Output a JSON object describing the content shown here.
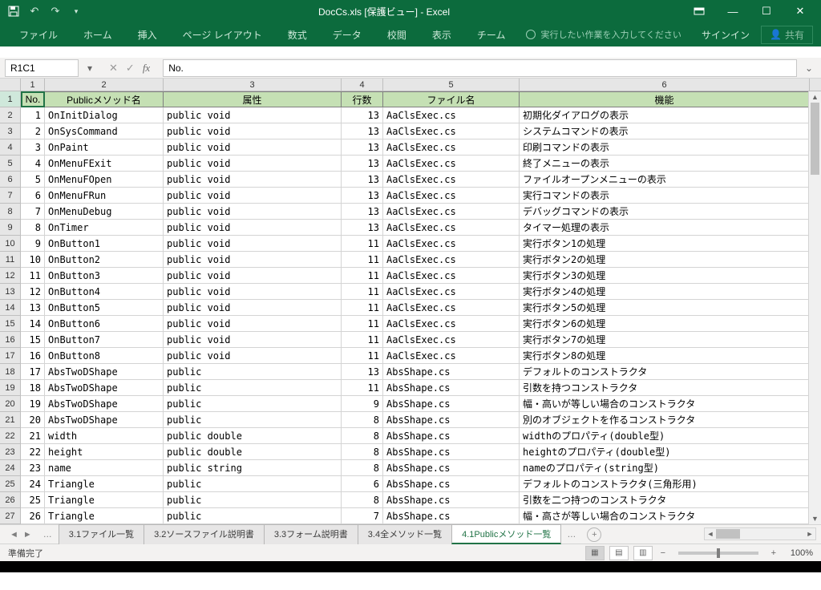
{
  "title": "DocCs.xls  [保護ビュー] - Excel",
  "qat": {
    "save": "💾"
  },
  "ribbon": {
    "tabs": [
      "ファイル",
      "ホーム",
      "挿入",
      "ページ レイアウト",
      "数式",
      "データ",
      "校閲",
      "表示",
      "チーム"
    ],
    "tellme": "実行したい作業を入力してください",
    "signin": "サインイン",
    "share": "共有"
  },
  "namebox": "R1C1",
  "formula": "No.",
  "colnums": [
    "1",
    "2",
    "3",
    "4",
    "5",
    "6"
  ],
  "headers": [
    "No.",
    "Publicメソッド名",
    "属性",
    "行数",
    "ファイル名",
    "機能"
  ],
  "rows": [
    {
      "n": "1",
      "no": "1",
      "m": "OnInitDialog",
      "a": "public void",
      "l": "13",
      "f": "AaClsExec.cs",
      "d": "初期化ダイアログの表示"
    },
    {
      "n": "2",
      "no": "2",
      "m": "OnSysCommand",
      "a": "public void",
      "l": "13",
      "f": "AaClsExec.cs",
      "d": "システムコマンドの表示"
    },
    {
      "n": "3",
      "no": "3",
      "m": "OnPaint",
      "a": "public void",
      "l": "13",
      "f": "AaClsExec.cs",
      "d": "印刷コマンドの表示"
    },
    {
      "n": "4",
      "no": "4",
      "m": "OnMenuFExit",
      "a": "public void",
      "l": "13",
      "f": "AaClsExec.cs",
      "d": "終了メニューの表示"
    },
    {
      "n": "5",
      "no": "5",
      "m": "OnMenuFOpen",
      "a": "public void",
      "l": "13",
      "f": "AaClsExec.cs",
      "d": "ファイルオープンメニューの表示"
    },
    {
      "n": "6",
      "no": "6",
      "m": "OnMenuFRun",
      "a": "public void",
      "l": "13",
      "f": "AaClsExec.cs",
      "d": "実行コマンドの表示"
    },
    {
      "n": "7",
      "no": "7",
      "m": "OnMenuDebug",
      "a": "public void",
      "l": "13",
      "f": "AaClsExec.cs",
      "d": "デバッグコマンドの表示"
    },
    {
      "n": "8",
      "no": "8",
      "m": "OnTimer",
      "a": "public void",
      "l": "13",
      "f": "AaClsExec.cs",
      "d": "タイマー処理の表示"
    },
    {
      "n": "9",
      "no": "9",
      "m": "OnButton1",
      "a": "public void",
      "l": "11",
      "f": "AaClsExec.cs",
      "d": "実行ボタン1の処理"
    },
    {
      "n": "10",
      "no": "10",
      "m": "OnButton2",
      "a": "public void",
      "l": "11",
      "f": "AaClsExec.cs",
      "d": "実行ボタン2の処理"
    },
    {
      "n": "11",
      "no": "11",
      "m": "OnButton3",
      "a": "public void",
      "l": "11",
      "f": "AaClsExec.cs",
      "d": "実行ボタン3の処理"
    },
    {
      "n": "12",
      "no": "12",
      "m": "OnButton4",
      "a": "public void",
      "l": "11",
      "f": "AaClsExec.cs",
      "d": "実行ボタン4の処理"
    },
    {
      "n": "13",
      "no": "13",
      "m": "OnButton5",
      "a": "public void",
      "l": "11",
      "f": "AaClsExec.cs",
      "d": "実行ボタン5の処理"
    },
    {
      "n": "14",
      "no": "14",
      "m": "OnButton6",
      "a": "public void",
      "l": "11",
      "f": "AaClsExec.cs",
      "d": "実行ボタン6の処理"
    },
    {
      "n": "15",
      "no": "15",
      "m": "OnButton7",
      "a": "public void",
      "l": "11",
      "f": "AaClsExec.cs",
      "d": "実行ボタン7の処理"
    },
    {
      "n": "16",
      "no": "16",
      "m": "OnButton8",
      "a": "public void",
      "l": "11",
      "f": "AaClsExec.cs",
      "d": "実行ボタン8の処理"
    },
    {
      "n": "17",
      "no": "17",
      "m": "AbsTwoDShape",
      "a": "public",
      "l": "13",
      "f": "AbsShape.cs",
      "d": "デフォルトのコンストラクタ"
    },
    {
      "n": "18",
      "no": "18",
      "m": "AbsTwoDShape",
      "a": "public",
      "l": "11",
      "f": "AbsShape.cs",
      "d": "引数を持つコンストラクタ"
    },
    {
      "n": "19",
      "no": "19",
      "m": "AbsTwoDShape",
      "a": "public",
      "l": "9",
      "f": "AbsShape.cs",
      "d": "幅・高いが等しい場合のコンストラクタ"
    },
    {
      "n": "20",
      "no": "20",
      "m": "AbsTwoDShape",
      "a": "public",
      "l": "8",
      "f": "AbsShape.cs",
      "d": "別のオブジェクトを作るコンストラクタ"
    },
    {
      "n": "21",
      "no": "21",
      "m": "width",
      "a": "public double",
      "l": "8",
      "f": "AbsShape.cs",
      "d": "widthのプロパティ(double型)"
    },
    {
      "n": "22",
      "no": "22",
      "m": "height",
      "a": "public double",
      "l": "8",
      "f": "AbsShape.cs",
      "d": "heightのプロパティ(double型)"
    },
    {
      "n": "23",
      "no": "23",
      "m": "name",
      "a": "public string",
      "l": "8",
      "f": "AbsShape.cs",
      "d": "nameのプロパティ(string型)"
    },
    {
      "n": "24",
      "no": "24",
      "m": "Triangle",
      "a": "public",
      "l": "6",
      "f": "AbsShape.cs",
      "d": "デフォルトのコンストラクタ(三角形用)"
    },
    {
      "n": "25",
      "no": "25",
      "m": "Triangle",
      "a": "public",
      "l": "8",
      "f": "AbsShape.cs",
      "d": "引数を二つ持つのコンストラクタ"
    },
    {
      "n": "26",
      "no": "26",
      "m": "Triangle",
      "a": "public",
      "l": "7",
      "f": "AbsShape.cs",
      "d": "幅・高さが等しい場合のコンストラクタ"
    }
  ],
  "sheets": {
    "tabs": [
      "3.1ファイル一覧",
      "3.2ソースファイル説明書",
      "3.3フォーム説明書",
      "3.4全メソッド一覧",
      "4.1Publicメソッド一覧"
    ],
    "active": 4
  },
  "status": {
    "ready": "準備完了",
    "zoom": "100%"
  }
}
